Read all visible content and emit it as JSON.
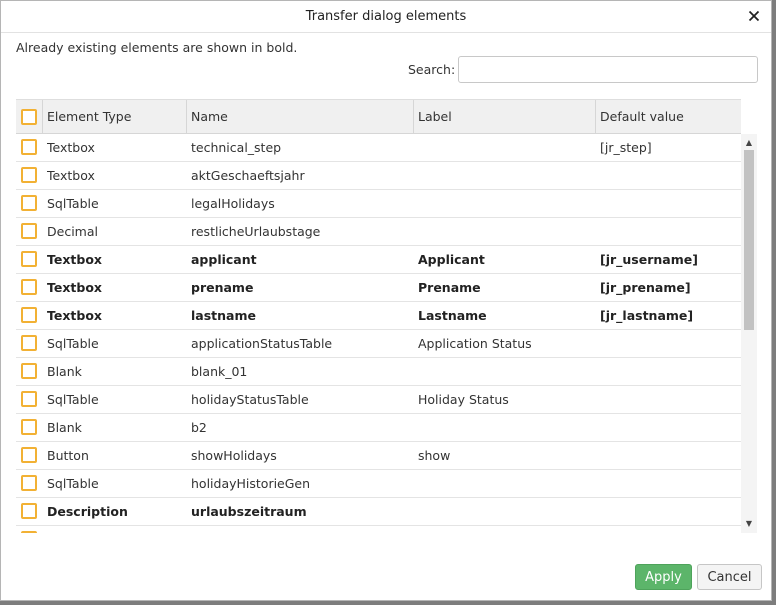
{
  "dialog": {
    "title": "Transfer dialog elements",
    "info": "Already existing elements are shown in bold.",
    "search_label": "Search:",
    "search_value": ""
  },
  "table": {
    "columns": [
      "Element Type",
      "Name",
      "Label",
      "Default value"
    ],
    "rows": [
      {
        "type": "Textbox",
        "name": "technical_step",
        "label": "",
        "default": "[jr_step]",
        "existing": false
      },
      {
        "type": "Textbox",
        "name": "aktGeschaeftsjahr",
        "label": "",
        "default": "",
        "existing": false
      },
      {
        "type": "SqlTable",
        "name": "legalHolidays",
        "label": "",
        "default": "",
        "existing": false
      },
      {
        "type": "Decimal",
        "name": "restlicheUrlaubstage",
        "label": "",
        "default": "",
        "existing": false
      },
      {
        "type": "Textbox",
        "name": "applicant",
        "label": "Applicant",
        "default": "[jr_username]",
        "existing": true
      },
      {
        "type": "Textbox",
        "name": "prename",
        "label": "Prename",
        "default": "[jr_prename]",
        "existing": true
      },
      {
        "type": "Textbox",
        "name": "lastname",
        "label": "Lastname",
        "default": "[jr_lastname]",
        "existing": true
      },
      {
        "type": "SqlTable",
        "name": "applicationStatusTable",
        "label": "Application Status",
        "default": "",
        "existing": false
      },
      {
        "type": "Blank",
        "name": "blank_01",
        "label": "",
        "default": "",
        "existing": false
      },
      {
        "type": "SqlTable",
        "name": "holidayStatusTable",
        "label": "Holiday Status",
        "default": "",
        "existing": false
      },
      {
        "type": "Blank",
        "name": "b2",
        "label": "",
        "default": "",
        "existing": false
      },
      {
        "type": "Button",
        "name": "showHolidays",
        "label": "show",
        "default": "",
        "existing": false
      },
      {
        "type": "SqlTable",
        "name": "holidayHistorieGen",
        "label": "",
        "default": "",
        "existing": false
      },
      {
        "type": "Description",
        "name": "urlaubszeitraum",
        "label": "",
        "default": "",
        "existing": true
      },
      {
        "type": "",
        "name": "",
        "label": "",
        "default": "",
        "existing": false
      }
    ]
  },
  "scroll": {
    "position_fraction": 0.0,
    "visible_fraction": 0.49
  },
  "buttons": {
    "apply": "Apply",
    "cancel": "Cancel"
  },
  "colors": {
    "accent_checkbox": "#f2b134",
    "apply_button": "#5cb56a"
  },
  "icons": {
    "close": "close-icon",
    "scroll_up": "scroll-up-arrow-icon",
    "scroll_down": "scroll-down-arrow-icon"
  }
}
